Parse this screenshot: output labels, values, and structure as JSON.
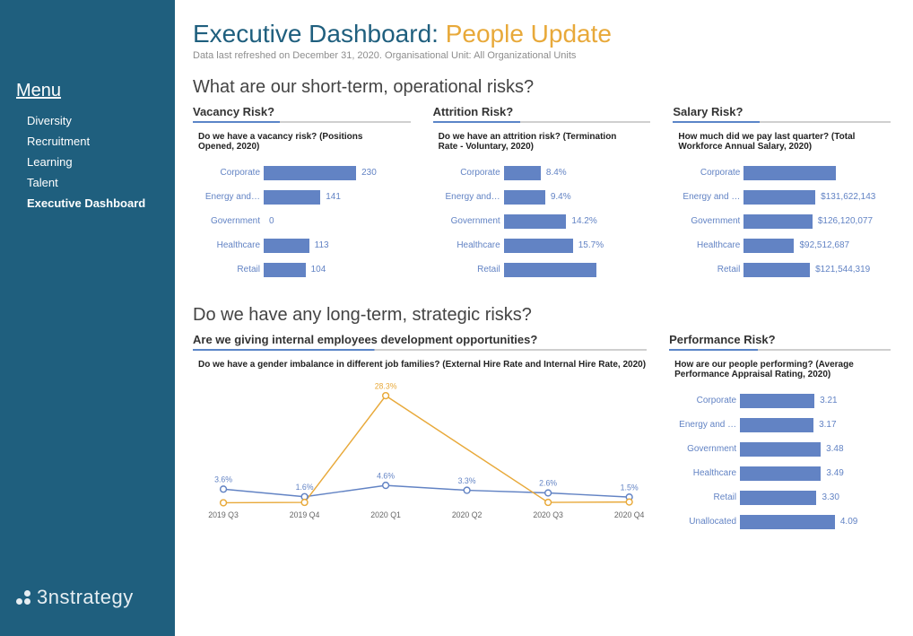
{
  "sidebar": {
    "menu_label": "Menu",
    "items": [
      {
        "label": "Diversity"
      },
      {
        "label": "Recruitment"
      },
      {
        "label": "Learning"
      },
      {
        "label": "Talent"
      },
      {
        "label": "Executive Dashboard"
      }
    ],
    "logo_text": "3nstrategy"
  },
  "header": {
    "title_prefix": "Executive Dashboard: ",
    "title_accent": "People Update",
    "subtitle": "Data last refreshed on December 31, 2020. Organisational Unit: All Organizational Units"
  },
  "section1": {
    "question": "What are our short-term, operational risks?",
    "vacancy": {
      "title": "Vacancy Risk?",
      "chart_question": "Do we have a vacancy risk? (Positions Opened, 2020)"
    },
    "attrition": {
      "title": "Attrition Risk?",
      "chart_question": "Do we have an attrition risk? (Termination Rate - Voluntary, 2020)"
    },
    "salary": {
      "title": "Salary Risk?",
      "chart_question": "How much did we pay last quarter? (Total Workforce Annual Salary, 2020)"
    }
  },
  "section2": {
    "question": "Do we have any long-term, strategic risks?",
    "development": {
      "title": "Are we giving internal employees development opportunities?",
      "chart_question": "Do we have a gender imbalance in different job families? (External Hire Rate and Internal Hire Rate, 2020)"
    },
    "performance": {
      "title": "Performance Risk?",
      "chart_question": "How are our people performing? (Average Performance Appraisal Rating, 2020)"
    }
  },
  "chart_data": [
    {
      "id": "vacancy",
      "type": "bar",
      "orientation": "horizontal",
      "title": "Positions Opened, 2020",
      "categories": [
        "Corporate",
        "Energy and…",
        "Government",
        "Healthcare",
        "Retail"
      ],
      "values": [
        230,
        141,
        0,
        113,
        104
      ],
      "value_labels": [
        "230",
        "141",
        "0",
        "113",
        "104"
      ],
      "max": 230
    },
    {
      "id": "attrition",
      "type": "bar",
      "orientation": "horizontal",
      "title": "Termination Rate - Voluntary, 2020",
      "categories": [
        "Corporate",
        "Energy and…",
        "Government",
        "Healthcare",
        "Retail"
      ],
      "values": [
        8.4,
        9.4,
        14.2,
        15.7,
        21.0
      ],
      "value_labels": [
        "8.4%",
        "9.4%",
        "14.2%",
        "15.7%",
        ""
      ],
      "max": 21.0
    },
    {
      "id": "salary",
      "type": "bar",
      "orientation": "horizontal",
      "title": "Total Workforce Annual Salary, 2020",
      "categories": [
        "Corporate",
        "Energy and …",
        "Government",
        "Healthcare",
        "Retail"
      ],
      "values": [
        170000000,
        131622143,
        126120077,
        92512687,
        121544319
      ],
      "value_labels": [
        "",
        "$131,622,143",
        "$126,120,077",
        "$92,512,687",
        "$121,544,319"
      ],
      "max": 170000000
    },
    {
      "id": "hire_rate",
      "type": "line",
      "title": "External Hire Rate and Internal Hire Rate, 2020",
      "x": [
        "2019 Q3",
        "2019 Q4",
        "2020 Q1",
        "2020 Q2",
        "2020 Q3",
        "2020 Q4"
      ],
      "series": [
        {
          "name": "External Hire Rate",
          "color": "#6283c4",
          "values": [
            3.6,
            1.6,
            4.6,
            3.3,
            2.6,
            1.5
          ],
          "labels": [
            "3.6%",
            "1.6%",
            "4.6%",
            "3.3%",
            "2.6%",
            "1.5%"
          ]
        },
        {
          "name": "Internal Hire Rate",
          "color": "#e8a93a",
          "values": [
            0.0,
            0.1,
            28.3,
            null,
            0.1,
            0.2
          ],
          "labels": [
            "",
            "",
            "28.3%",
            "",
            "",
            ""
          ]
        }
      ],
      "ylim": [
        0,
        30
      ]
    },
    {
      "id": "performance",
      "type": "bar",
      "orientation": "horizontal",
      "title": "Average Performance Appraisal Rating, 2020",
      "categories": [
        "Corporate",
        "Energy and …",
        "Government",
        "Healthcare",
        "Retail",
        "Unallocated"
      ],
      "values": [
        3.21,
        3.17,
        3.48,
        3.49,
        3.3,
        4.09
      ],
      "value_labels": [
        "3.21",
        "3.17",
        "3.48",
        "3.49",
        "3.30",
        "4.09"
      ],
      "max": 4.09
    }
  ]
}
